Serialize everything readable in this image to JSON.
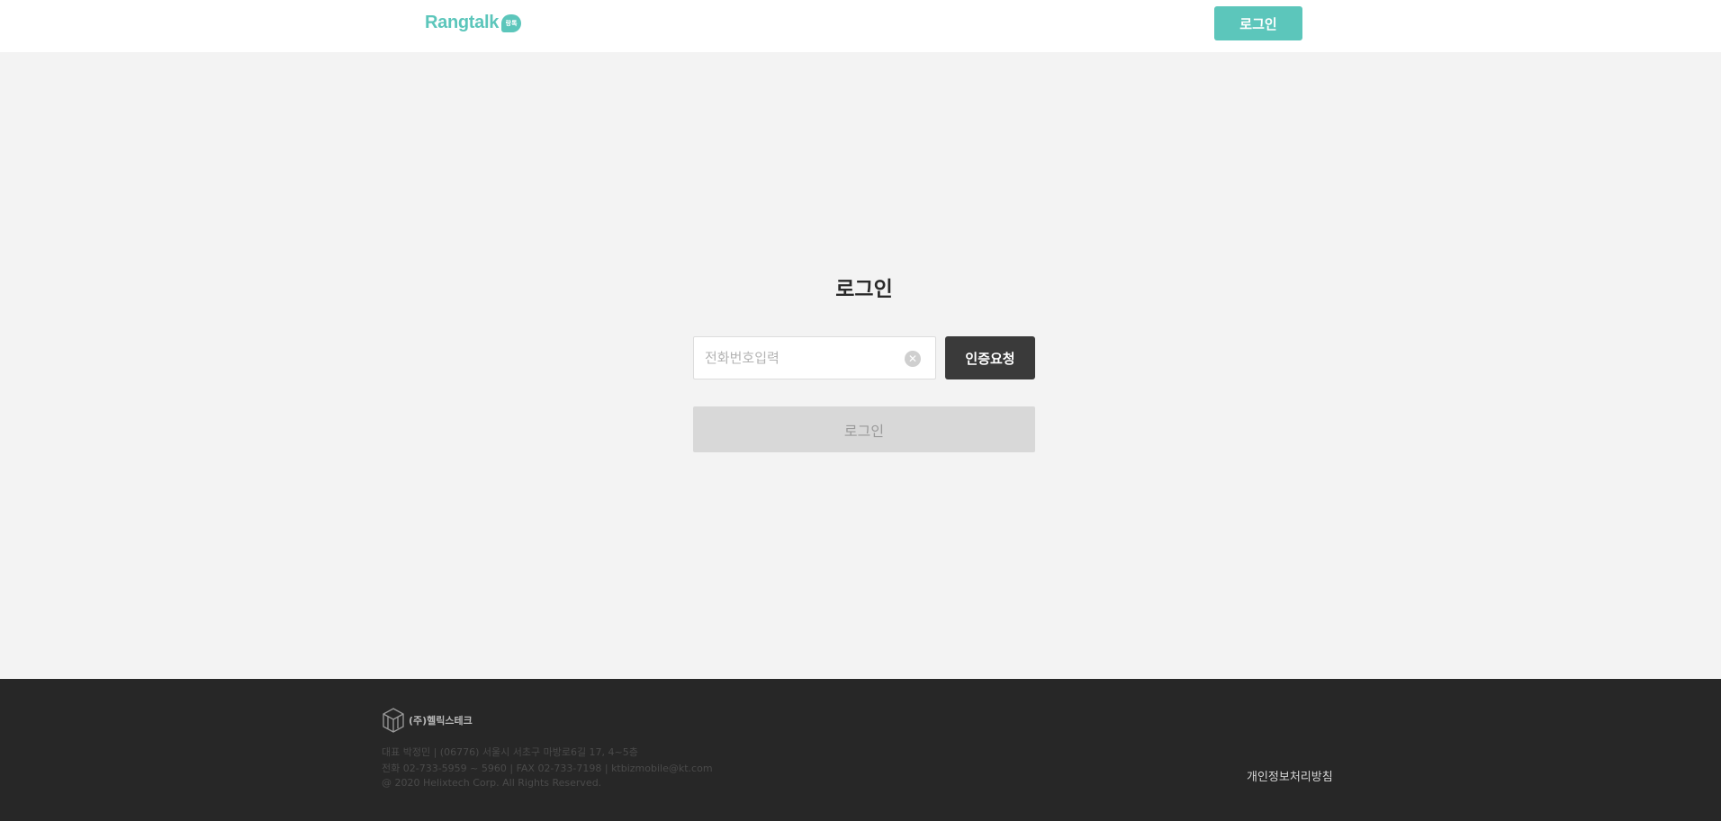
{
  "header": {
    "logo_text": "Rangtalk",
    "logo_badge": "랑톡",
    "login_label": "로그인"
  },
  "login": {
    "title": "로그인",
    "phone_placeholder": "전화번호입력",
    "phone_value": "",
    "verify_label": "인증요청",
    "submit_label": "로그인"
  },
  "footer": {
    "company_name": "(주)헬릭스테크",
    "lines": [
      "대표 박정민 | (06776) 서울시 서초구 마방로6길 17, 4~5층",
      "전화 02-733-5959 ~ 5960 | FAX 02-733-7198 | ktbizmobile@kt.com",
      "@ 2020 Helixtech Corp. All Rights Reserved."
    ],
    "privacy_label": "개인정보처리방침"
  },
  "colors": {
    "brand": "#5cc6bb",
    "footer_bg": "#272727",
    "page_bg": "#f3f3f3"
  }
}
